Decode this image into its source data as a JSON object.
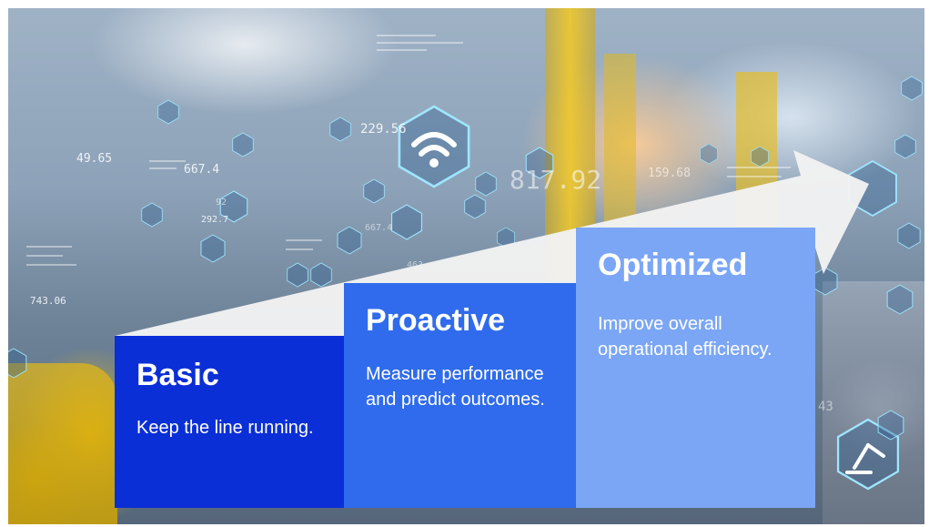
{
  "steps": [
    {
      "title": "Basic",
      "description": "Keep the line running."
    },
    {
      "title": "Proactive",
      "description": "Measure performance and predict outcomes."
    },
    {
      "title": "Optimized",
      "description": "Improve overall operational efficiency."
    }
  ],
  "overlay_numbers": [
    "49.65",
    "667.4",
    "229.56",
    "817.92",
    "159.68",
    "292.7",
    "667.4",
    "743.06",
    "92",
    "43",
    "463"
  ],
  "colors": {
    "basic": "#0a2fd6",
    "proactive": "#2f6bec",
    "optimized": "#7ba6f5",
    "arrow": "#f2f2f2",
    "hex_stroke": "#9fe6ff"
  }
}
